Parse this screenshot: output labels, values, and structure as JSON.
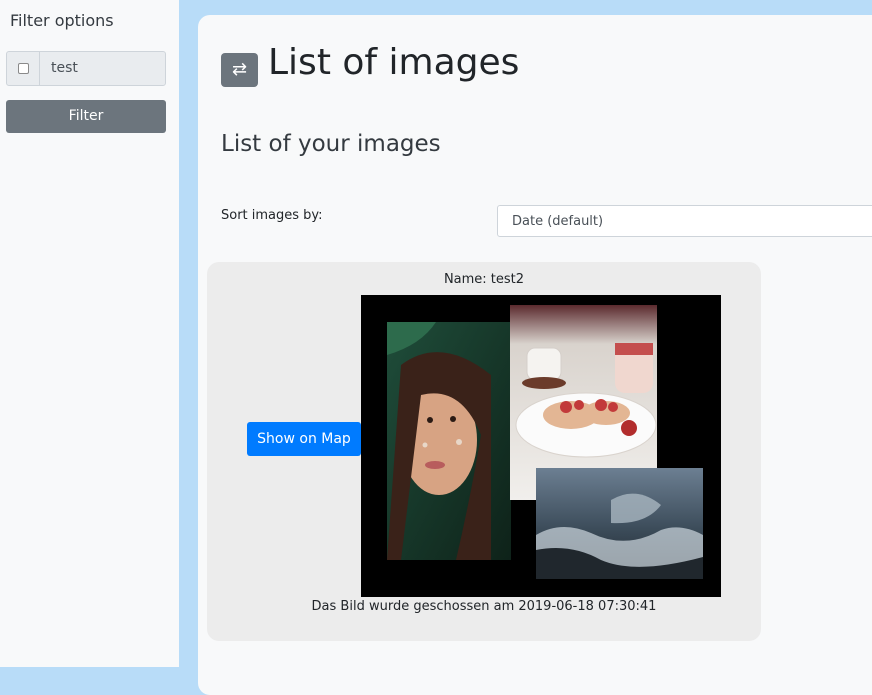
{
  "sidebar": {
    "title": "Filter options",
    "filter_text": "test",
    "filter_button_label": "Filter"
  },
  "header": {
    "swap_icon": "⇄",
    "title": "List of images"
  },
  "main": {
    "subtitle": "List of your images",
    "sort_label": "Sort images by:",
    "sort_value": "Date (default)"
  },
  "image_card": {
    "name": "Name: test2",
    "map_button_label": "Show on Map",
    "caption": "Das Bild wurde geschossen am 2019-06-18 07:30:41"
  },
  "colors": {
    "background": "#b8dcf8",
    "panel": "#f8f9fa",
    "primary": "#007bff",
    "secondary": "#6c757d"
  }
}
